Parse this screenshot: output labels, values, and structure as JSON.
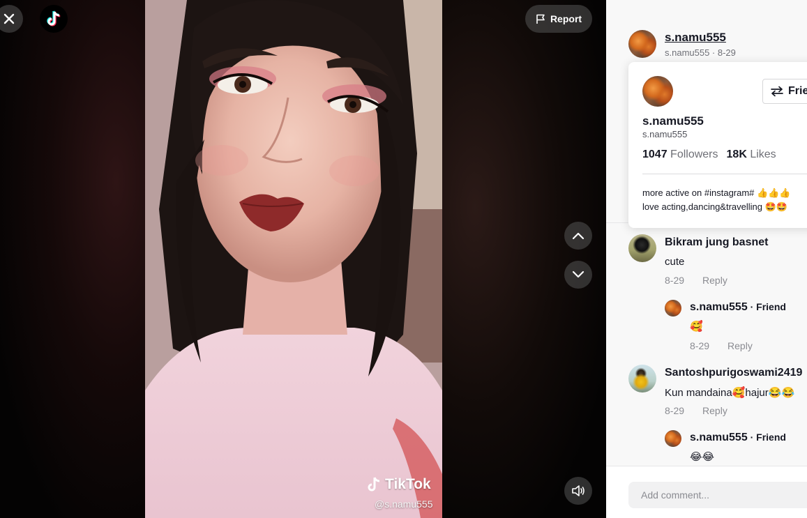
{
  "header": {
    "report_label": "Report"
  },
  "video": {
    "watermark_brand": "TikTok",
    "watermark_handle": "@s.namu555"
  },
  "author": {
    "display_name": "s.namu555",
    "meta": "s.namu555 · 8-29"
  },
  "profile_card": {
    "follow_state_label": "Friends",
    "name": "s.namu555",
    "handle": "s.namu555",
    "followers_count": "1047",
    "followers_label": "Followers",
    "likes_count": "18K",
    "likes_label": "Likes",
    "bio_line_1": "more active on #instagram# 👍👍👍",
    "bio_line_2": "love acting,dancing&travelling 🤩🤩"
  },
  "comments": [
    {
      "user": "Bikram jung basnet",
      "text": "cute",
      "date": "8-29",
      "reply_label": "Reply",
      "replies": [
        {
          "user": "s.namu555",
          "tag": " · Friend",
          "text": "🥰",
          "date": "8-29",
          "reply_label": "Reply"
        }
      ]
    },
    {
      "user": "Santoshpurigoswami2419",
      "text": "Kun mandaina🥰hajur😂😂",
      "date": "8-29",
      "reply_label": "Reply",
      "replies": [
        {
          "user": "s.namu555",
          "tag": " · Friend",
          "text": "😂😂"
        }
      ]
    }
  ],
  "composer": {
    "placeholder": "Add comment..."
  }
}
